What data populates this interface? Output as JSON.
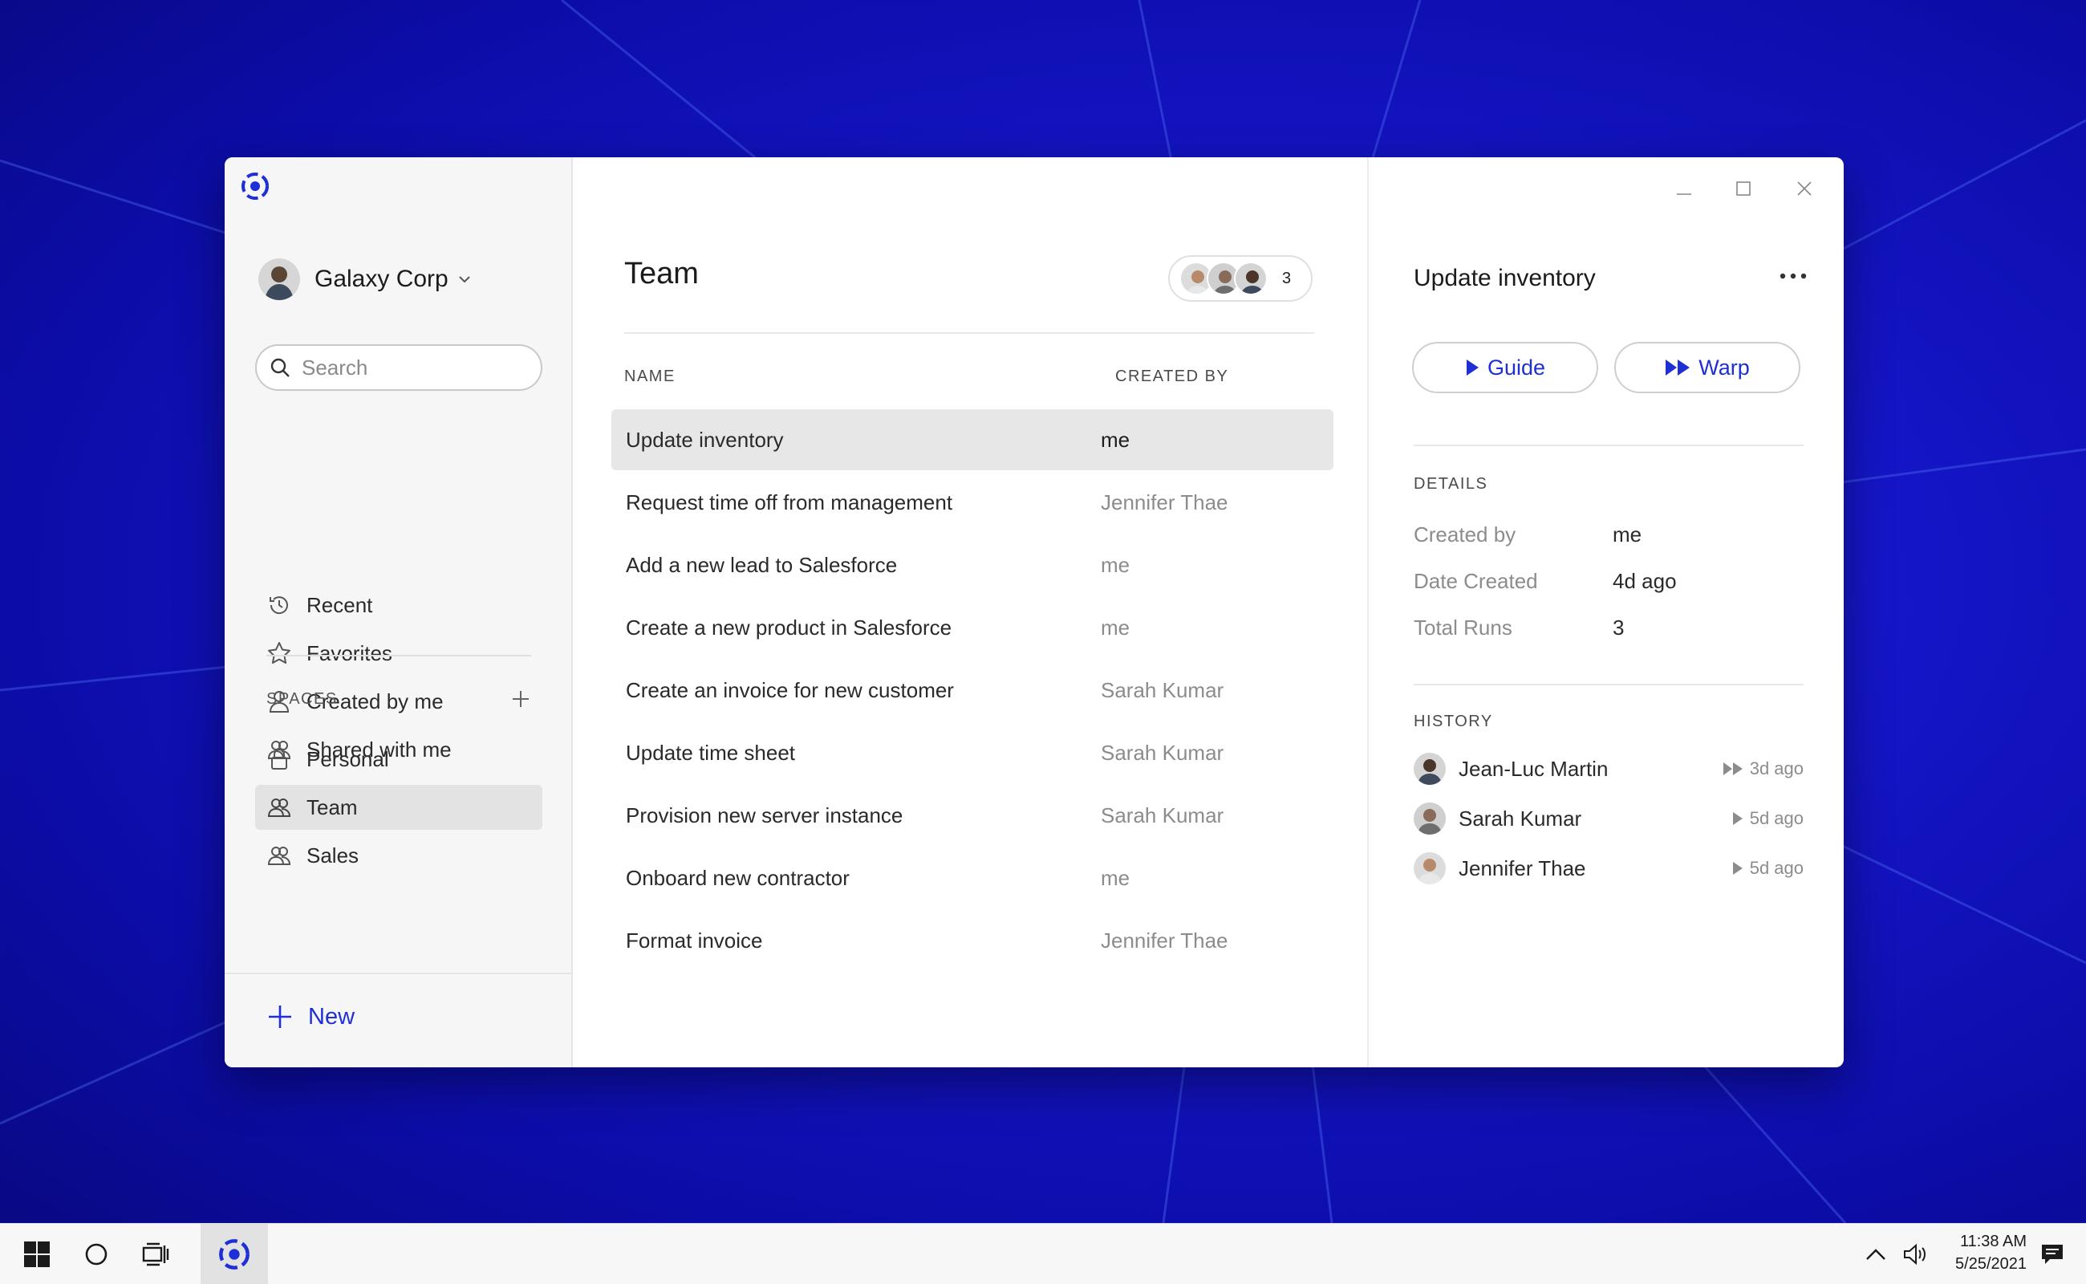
{
  "colors": {
    "accent": "#1f2fd6",
    "desktop": "#1516c9",
    "selected_row": "#e7e7e7"
  },
  "sidebar": {
    "workspace_name": "Galaxy Corp",
    "search_placeholder": "Search",
    "nav": [
      {
        "label": "Recent",
        "icon": "history-icon"
      },
      {
        "label": "Favorites",
        "icon": "star-icon"
      },
      {
        "label": "Created by me",
        "icon": "person-icon"
      },
      {
        "label": "Shared with me",
        "icon": "people-icon"
      }
    ],
    "spaces_heading": "SPACES",
    "spaces": [
      {
        "label": "Personal",
        "icon": "lock-icon"
      },
      {
        "label": "Team",
        "icon": "people-icon",
        "active": true
      },
      {
        "label": "Sales",
        "icon": "people-icon"
      }
    ],
    "new_label": "New"
  },
  "main": {
    "title": "Team",
    "member_count": "3",
    "columns": {
      "name": "NAME",
      "created_by": "CREATED BY"
    },
    "rows": [
      {
        "name": "Update inventory",
        "created_by": "me",
        "selected": true
      },
      {
        "name": "Request time off from management",
        "created_by": "Jennifer Thae"
      },
      {
        "name": "Add a new lead to Salesforce",
        "created_by": "me"
      },
      {
        "name": "Create a new product in Salesforce",
        "created_by": "me"
      },
      {
        "name": "Create an invoice for new customer",
        "created_by": "Sarah Kumar"
      },
      {
        "name": "Update time sheet",
        "created_by": "Sarah Kumar"
      },
      {
        "name": "Provision new server instance",
        "created_by": "Sarah Kumar"
      },
      {
        "name": "Onboard new contractor",
        "created_by": "me"
      },
      {
        "name": "Format invoice",
        "created_by": "Jennifer Thae"
      }
    ]
  },
  "detail": {
    "title": "Update inventory",
    "guide_label": "Guide",
    "warp_label": "Warp",
    "details_heading": "DETAILS",
    "details": [
      {
        "key": "Created by",
        "value": "me"
      },
      {
        "key": "Date Created",
        "value": "4d ago"
      },
      {
        "key": "Total Runs",
        "value": "3"
      }
    ],
    "history_heading": "HISTORY",
    "history": [
      {
        "name": "Jean-Luc Martin",
        "mode": "warp",
        "when": "3d ago"
      },
      {
        "name": "Sarah Kumar",
        "mode": "guide",
        "when": "5d ago"
      },
      {
        "name": "Jennifer Thae",
        "mode": "guide",
        "when": "5d ago"
      }
    ]
  },
  "taskbar": {
    "time": "11:38 AM",
    "date": "5/25/2021"
  }
}
